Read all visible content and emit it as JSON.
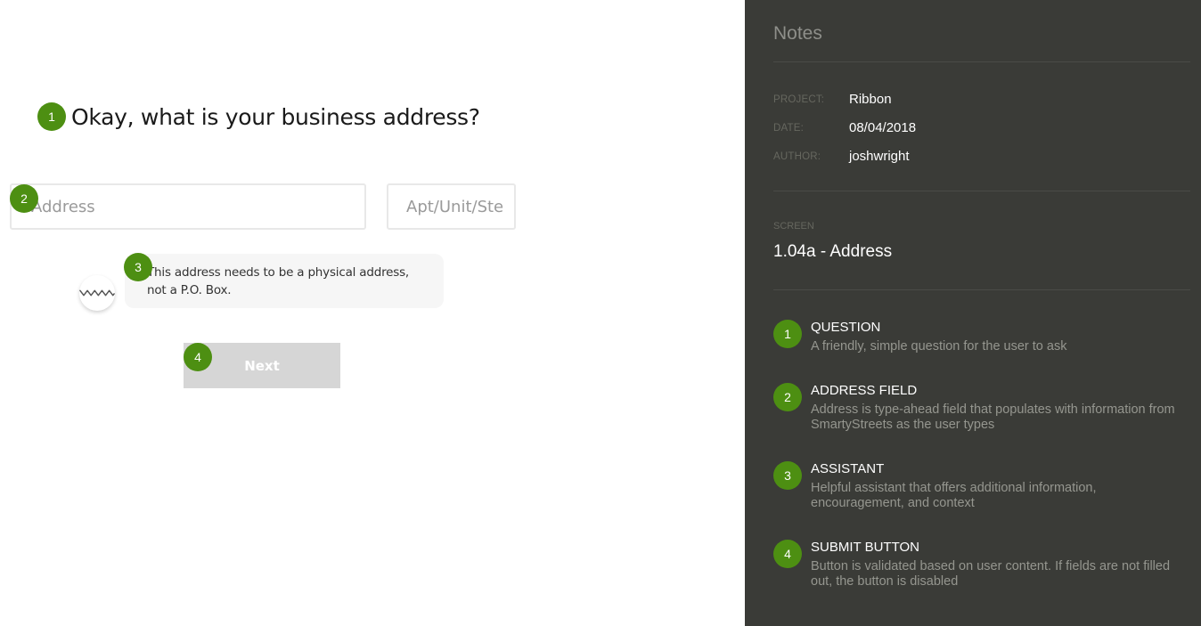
{
  "mock": {
    "question": "Okay, what is your business address?",
    "address_placeholder": "Address",
    "apt_placeholder": "Apt/Unit/Ste",
    "assistant_message": "This address needs to be a physical address, not a P.O. Box.",
    "next_label": "Next",
    "badges": [
      "1",
      "2",
      "3",
      "4"
    ]
  },
  "notes": {
    "title": "Notes",
    "meta": [
      {
        "label": "PROJECT:",
        "value": "Ribbon"
      },
      {
        "label": "DATE:",
        "value": "08/04/2018"
      },
      {
        "label": "AUTHOR:",
        "value": "joshwright"
      }
    ],
    "screen_label": "SCREEN",
    "screen_value": "1.04a - Address",
    "items": [
      {
        "num": "1",
        "title": "QUESTION",
        "desc": "A friendly, simple question for the user to ask"
      },
      {
        "num": "2",
        "title": "ADDRESS FIELD",
        "desc": "Address is type-ahead field that populates with information from SmartyStreets as the user types"
      },
      {
        "num": "3",
        "title": "ASSISTANT",
        "desc": "Helpful assistant that offers additional information, encouragement, and context"
      },
      {
        "num": "4",
        "title": "SUBMIT BUTTON",
        "desc": "Button is validated based on user content. If fields are not filled out, the button is disabled"
      }
    ]
  },
  "colors": {
    "accent_green": "#4d8f12",
    "notes_background": "#3a3b37",
    "disabled_button": "#d6d6d6"
  }
}
